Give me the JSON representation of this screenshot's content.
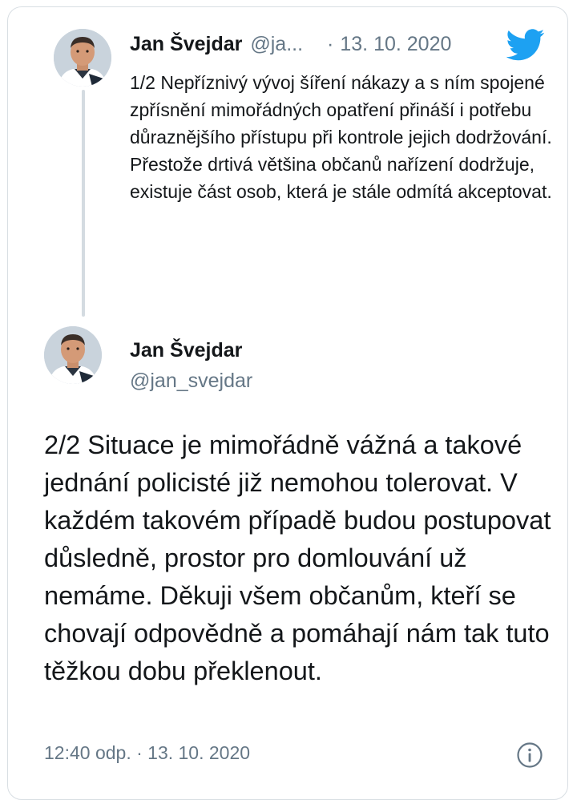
{
  "parent_tweet": {
    "author_name": "Jan Švejdar",
    "author_handle": "@ja...",
    "separator": "·",
    "date": "13. 10. 2020",
    "text": "1/2 Nepříznivý vývoj šíření nákazy a s ním spojené zpřísnění mimořádných opatření přináší i potřebu důraznějšího přístupu při kontrole jejich dodržování. Přestože drtivá většina občanů nařízení dodržuje, existuje část osob, která je stále odmítá akceptovat."
  },
  "main_tweet": {
    "author_name": "Jan Švejdar",
    "author_handle": "@jan_svejdar",
    "text": "2/2 Situace je mimořádně vážná a takové jednání policisté již nemohou tolerovat. V každém takovém případě budou postupovat důsledně, prostor pro domlouvání už nemáme. Děkuji všem občanům, kteří se chovají odpovědně a pomáhají nám tak tuto těžkou dobu překlenout.",
    "timestamp": "12:40 odp. · 13. 10. 2020"
  },
  "icons": {
    "brand": "twitter-bird-icon",
    "info": "info-icon"
  },
  "colors": {
    "brand_blue": "#1da1f2",
    "secondary_text": "#657786",
    "thread_line": "#d4dbe1",
    "border": "#d8dee3"
  }
}
